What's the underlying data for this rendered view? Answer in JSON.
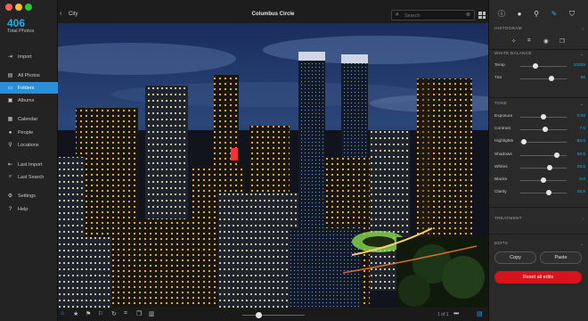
{
  "window": {
    "title": "Columbus Circle",
    "breadcrumb": "City"
  },
  "library": {
    "count": "406",
    "count_label": "Total Photos"
  },
  "sidebar": {
    "items": [
      {
        "label": "Import",
        "icon": "import-icon",
        "glyph": "⇥"
      },
      {
        "label": "All Photos",
        "icon": "photos-icon",
        "glyph": "▤"
      },
      {
        "label": "Folders",
        "icon": "folder-icon",
        "glyph": "▭",
        "active": true
      },
      {
        "label": "Albums",
        "icon": "albums-icon",
        "glyph": "▣"
      },
      {
        "label": "Calendar",
        "icon": "calendar-icon",
        "glyph": "▦"
      },
      {
        "label": "People",
        "icon": "people-icon",
        "glyph": "●"
      },
      {
        "label": "Locations",
        "icon": "location-pin-icon",
        "glyph": "⚲"
      },
      {
        "label": "Last Import",
        "icon": "last-import-icon",
        "glyph": "⇤"
      },
      {
        "label": "Last Search",
        "icon": "last-search-icon",
        "glyph": "⌕"
      },
      {
        "label": "Settings",
        "icon": "gear-icon",
        "glyph": "⚙"
      },
      {
        "label": "Help",
        "icon": "help-icon",
        "glyph": "?"
      }
    ]
  },
  "search": {
    "placeholder": "Search"
  },
  "pager": "1 of 1",
  "panel": {
    "sections": {
      "histogram": "HISTOGRAM",
      "white_balance": "WHITE BALANCE",
      "tone": "TONE",
      "treatment": "TREATMENT",
      "edits": "EDITS"
    },
    "white_balance": [
      {
        "label": "Temp",
        "value": "10335",
        "level": 0.32
      },
      {
        "label": "Tint",
        "value": "55",
        "level": 0.68
      }
    ],
    "tone": [
      {
        "label": "Exposure",
        "value": "0.00",
        "level": 0.5
      },
      {
        "label": "Contrast",
        "value": "7.0",
        "level": 0.54
      },
      {
        "label": "Highlights",
        "value": "-83.0",
        "level": 0.08
      },
      {
        "label": "Shadows",
        "value": "58.5",
        "level": 0.79
      },
      {
        "label": "Whites",
        "value": "28.5",
        "level": 0.64
      },
      {
        "label": "Blacks",
        "value": "0.0",
        "level": 0.5
      },
      {
        "label": "Clarity",
        "value": "25.5",
        "level": 0.62
      }
    ],
    "copy_label": "Copy",
    "paste_label": "Paste",
    "reset_label": "Reset all edits"
  },
  "colors": {
    "accent": "#2ba8e6",
    "active_nav": "#2a8fd8",
    "reset": "#d9131d"
  }
}
